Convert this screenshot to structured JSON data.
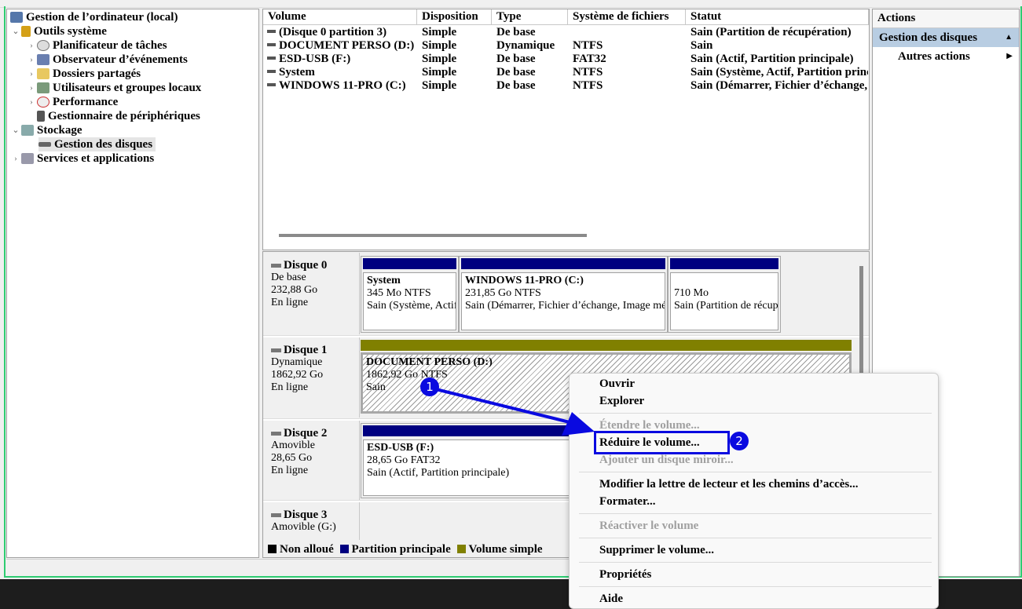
{
  "tree": {
    "root": "Gestion de l’ordinateur (local)",
    "items": [
      {
        "label": "Outils système"
      },
      {
        "label": "Planificateur de tâches"
      },
      {
        "label": "Observateur d’événements"
      },
      {
        "label": "Dossiers partagés"
      },
      {
        "label": "Utilisateurs et groupes locaux"
      },
      {
        "label": "Performance"
      },
      {
        "label": "Gestionnaire de périphériques"
      },
      {
        "label": "Stockage"
      },
      {
        "label": "Gestion des disques"
      },
      {
        "label": "Services et applications"
      }
    ]
  },
  "volumes": {
    "headers": [
      "Volume",
      "Disposition",
      "Type",
      "Système de fichiers",
      "Statut"
    ],
    "rows": [
      [
        "(Disque 0 partition 3)",
        "Simple",
        "De base",
        "",
        "Sain (Partition de récupération)"
      ],
      [
        "DOCUMENT PERSO (D:)",
        "Simple",
        "Dynamique",
        "NTFS",
        "Sain"
      ],
      [
        "ESD-USB (F:)",
        "Simple",
        "De base",
        "FAT32",
        "Sain (Actif, Partition principale)"
      ],
      [
        "System",
        "Simple",
        "De base",
        "NTFS",
        "Sain (Système, Actif, Partition principale)"
      ],
      [
        "WINDOWS 11-PRO (C:)",
        "Simple",
        "De base",
        "NTFS",
        "Sain (Démarrer, Fichier d’échange, Image mémoire)"
      ]
    ]
  },
  "disks": [
    {
      "name": "Disque 0",
      "type": "De base",
      "size": "232,88 Go",
      "state": "En ligne",
      "parts": [
        {
          "name": "System",
          "size": "345 Mo NTFS",
          "status": "Sain (Système, Actif, Partition principale)"
        },
        {
          "name": "WINDOWS 11-PRO  (C:)",
          "size": "231,85 Go NTFS",
          "status": "Sain (Démarrer, Fichier d’échange, Image mémoire)"
        },
        {
          "name": "",
          "size": "710 Mo",
          "status": "Sain (Partition de récupération)"
        }
      ]
    },
    {
      "name": "Disque 1",
      "type": "Dynamique",
      "size": "1862,92 Go",
      "state": "En ligne",
      "parts": [
        {
          "name": "DOCUMENT PERSO  (D:)",
          "size": "1862,92 Go NTFS",
          "status": "Sain"
        }
      ]
    },
    {
      "name": "Disque 2",
      "type": "Amovible",
      "size": "28,65 Go",
      "state": "En ligne",
      "parts": [
        {
          "name": "ESD-USB  (F:)",
          "size": "28,65 Go FAT32",
          "status": "Sain (Actif, Partition principale)"
        }
      ]
    },
    {
      "name": "Disque 3",
      "type": "Amovible (G:)"
    }
  ],
  "legend": [
    {
      "label": "Non alloué",
      "color": "#000000"
    },
    {
      "label": "Partition principale",
      "color": "#000080"
    },
    {
      "label": "Volume simple",
      "color": "#808000"
    }
  ],
  "actions": {
    "title": "Actions",
    "section": "Gestion des disques",
    "more": "Autres actions"
  },
  "menu": {
    "items": [
      "Ouvrir",
      "Explorer",
      "Étendre le volume...",
      "Réduire le volume...",
      "Ajouter un disque miroir...",
      "Modifier la lettre de lecteur et les chemins d’accès...",
      "Formater...",
      "Réactiver le volume",
      "Supprimer le volume...",
      "Propriétés",
      "Aide"
    ]
  },
  "annotations": [
    "1",
    "2"
  ],
  "colors": {
    "primary": "#000080",
    "simple": "#808000",
    "annotation": "#0a0ae0"
  }
}
